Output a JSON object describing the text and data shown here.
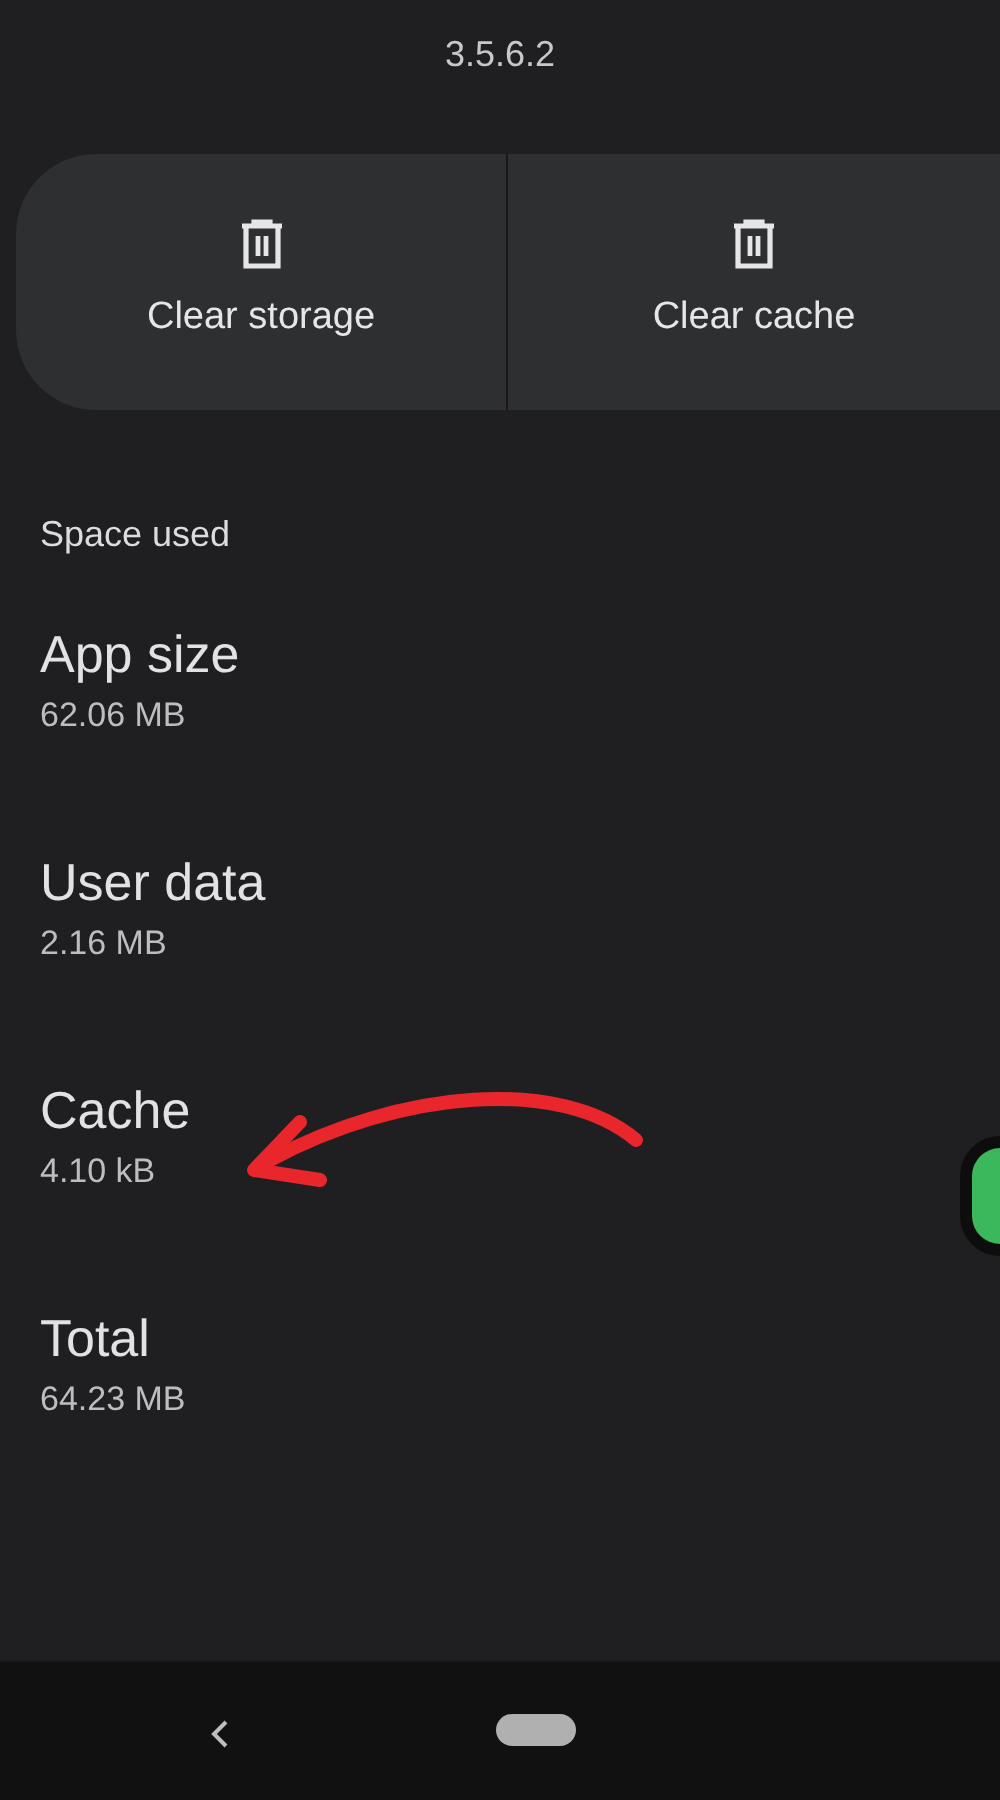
{
  "app_version": "3.5.6.2",
  "actions": [
    {
      "label": "Clear storage"
    },
    {
      "label": "Clear cache"
    }
  ],
  "space_used": {
    "heading": "Space used",
    "items": [
      {
        "label": "App size",
        "value": "62.06 MB"
      },
      {
        "label": "User data",
        "value": "2.16 MB"
      },
      {
        "label": "Cache",
        "value": "4.10 kB"
      },
      {
        "label": "Total",
        "value": "64.23 MB"
      }
    ]
  }
}
